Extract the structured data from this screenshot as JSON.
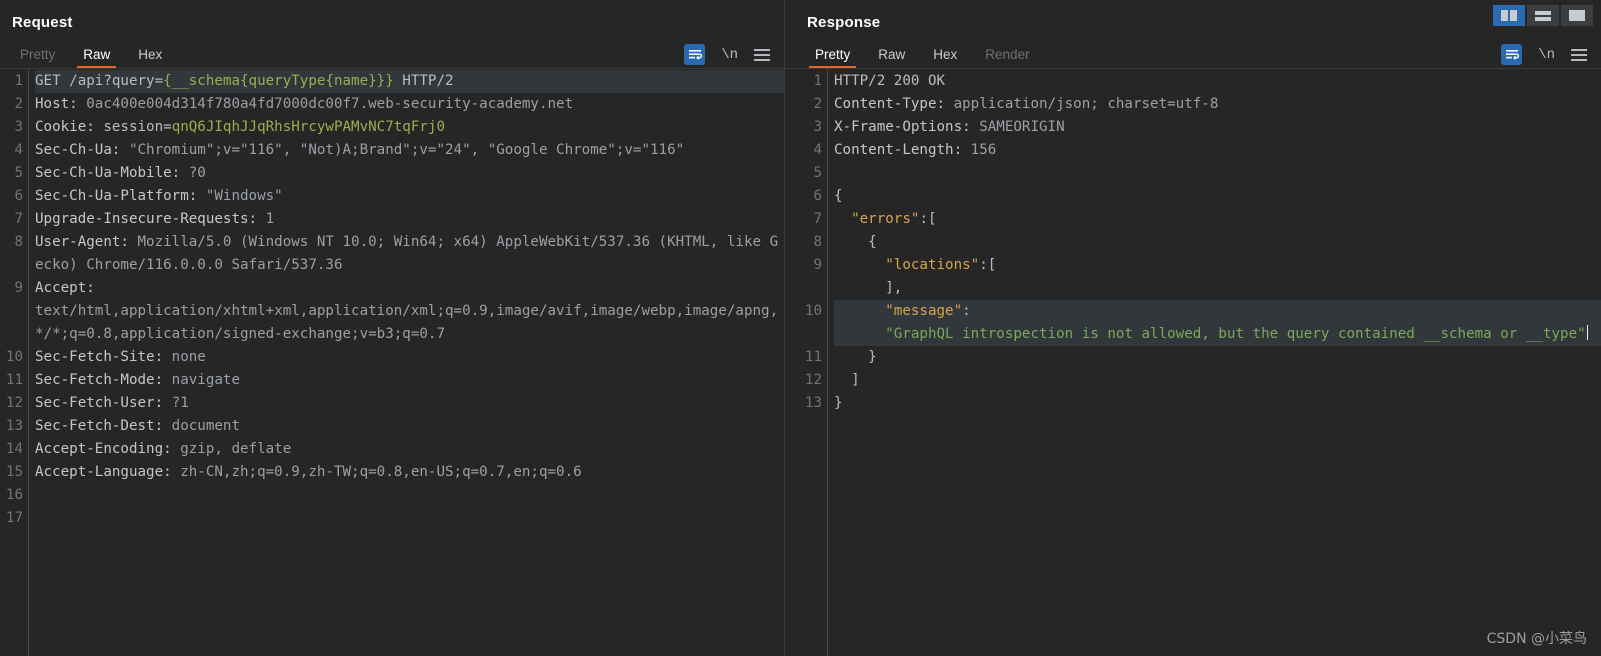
{
  "window": {
    "layout_buttons": [
      {
        "name": "split-vertical",
        "label": "",
        "active": true
      },
      {
        "name": "split-horizontal",
        "label": "",
        "active": false
      },
      {
        "name": "single-pane",
        "label": "",
        "active": false
      }
    ]
  },
  "watermark": "CSDN @小菜鸟",
  "request": {
    "title": "Request",
    "tabs": [
      {
        "label": "Pretty",
        "active": false,
        "enabled": true
      },
      {
        "label": "Raw",
        "active": true,
        "enabled": true
      },
      {
        "label": "Hex",
        "active": false,
        "enabled": true
      }
    ],
    "toolbar": {
      "wrap_icon": "word-wrap-icon",
      "newline_label": "\\n",
      "menu_icon": "hamburger-menu-icon"
    },
    "line_numbers": [
      "1",
      "2",
      "3",
      "4",
      "",
      "5",
      "6",
      "7",
      "8",
      "",
      "9",
      "",
      "",
      "10",
      "11",
      "12",
      "13",
      "14",
      "15",
      "16",
      "17"
    ],
    "lines": [
      {
        "number": "1",
        "highlight": true,
        "segments": [
          {
            "text": "GET /api?query=",
            "color": "default"
          },
          {
            "text": "{__schema{queryType{name}}}",
            "color": "green"
          },
          {
            "text": " HTTP/2",
            "color": "default"
          }
        ]
      },
      {
        "number": "2",
        "highlight": false,
        "segments": [
          {
            "text": "Host: ",
            "color": "hdr"
          },
          {
            "text": "0ac400e004d314f780a4fd7000dc00f7.web-security-academy.net",
            "color": "val"
          }
        ]
      },
      {
        "number": "3",
        "highlight": false,
        "segments": [
          {
            "text": "Cookie: ",
            "color": "hdr"
          },
          {
            "text": "session=",
            "color": "default"
          },
          {
            "text": "qnQ6JIqhJJqRhsHrcywPAMvNC7tqFrj0",
            "color": "green"
          }
        ]
      },
      {
        "number": "4",
        "highlight": false,
        "segments": [
          {
            "text": "Sec-Ch-Ua: ",
            "color": "hdr"
          },
          {
            "text": "\"Chromium\";v=\"116\", \"Not)A;Brand\";v=\"24\", \"Google Chrome\";v=\"116\"",
            "color": "val"
          }
        ]
      },
      {
        "number": "5",
        "highlight": false,
        "segments": [
          {
            "text": "Sec-Ch-Ua-Mobile: ",
            "color": "hdr"
          },
          {
            "text": "?0",
            "color": "val"
          }
        ]
      },
      {
        "number": "6",
        "highlight": false,
        "segments": [
          {
            "text": "Sec-Ch-Ua-Platform: ",
            "color": "hdr"
          },
          {
            "text": "\"Windows\"",
            "color": "val"
          }
        ]
      },
      {
        "number": "7",
        "highlight": false,
        "segments": [
          {
            "text": "Upgrade-Insecure-Requests: ",
            "color": "hdr"
          },
          {
            "text": "1",
            "color": "val"
          }
        ]
      },
      {
        "number": "8",
        "highlight": false,
        "segments": [
          {
            "text": "User-Agent: ",
            "color": "hdr"
          },
          {
            "text": "Mozilla/5.0 (Windows NT 10.0; Win64; x64) AppleWebKit/537.36 (KHTML, like Gecko) Chrome/116.0.0.0 Safari/537.36",
            "color": "val"
          }
        ]
      },
      {
        "number": "9",
        "highlight": false,
        "segments": [
          {
            "text": "Accept: ",
            "color": "hdr"
          },
          {
            "text": "\ntext/html,application/xhtml+xml,application/xml;q=0.9,image/avif,image/webp,image/apng,*/*;q=0.8,application/signed-exchange;v=b3;q=0.7",
            "color": "val"
          }
        ]
      },
      {
        "number": "10",
        "highlight": false,
        "segments": [
          {
            "text": "Sec-Fetch-Site: ",
            "color": "hdr"
          },
          {
            "text": "none",
            "color": "val"
          }
        ]
      },
      {
        "number": "11",
        "highlight": false,
        "segments": [
          {
            "text": "Sec-Fetch-Mode: ",
            "color": "hdr"
          },
          {
            "text": "navigate",
            "color": "val"
          }
        ]
      },
      {
        "number": "12",
        "highlight": false,
        "segments": [
          {
            "text": "Sec-Fetch-User: ",
            "color": "hdr"
          },
          {
            "text": "?1",
            "color": "val"
          }
        ]
      },
      {
        "number": "13",
        "highlight": false,
        "segments": [
          {
            "text": "Sec-Fetch-Dest: ",
            "color": "hdr"
          },
          {
            "text": "document",
            "color": "val"
          }
        ]
      },
      {
        "number": "14",
        "highlight": false,
        "segments": [
          {
            "text": "Accept-Encoding: ",
            "color": "hdr"
          },
          {
            "text": "gzip, deflate",
            "color": "val"
          }
        ]
      },
      {
        "number": "15",
        "highlight": false,
        "segments": [
          {
            "text": "Accept-Language: ",
            "color": "hdr"
          },
          {
            "text": "zh-CN,zh;q=0.9,zh-TW;q=0.8,en-US;q=0.7,en;q=0.6",
            "color": "val"
          }
        ]
      },
      {
        "number": "16",
        "highlight": false,
        "segments": [
          {
            "text": "",
            "color": "default"
          }
        ]
      },
      {
        "number": "17",
        "highlight": false,
        "segments": [
          {
            "text": "",
            "color": "default"
          }
        ]
      }
    ]
  },
  "response": {
    "title": "Response",
    "tabs": [
      {
        "label": "Pretty",
        "active": true,
        "enabled": true
      },
      {
        "label": "Raw",
        "active": false,
        "enabled": true
      },
      {
        "label": "Hex",
        "active": false,
        "enabled": true
      },
      {
        "label": "Render",
        "active": false,
        "enabled": false
      }
    ],
    "toolbar": {
      "wrap_icon": "word-wrap-icon",
      "newline_label": "\\n",
      "menu_icon": "hamburger-menu-icon"
    },
    "lines": [
      {
        "number": "1",
        "highlight": false,
        "segments": [
          {
            "text": "HTTP/2 200 OK",
            "color": "default"
          }
        ]
      },
      {
        "number": "2",
        "highlight": false,
        "segments": [
          {
            "text": "Content-Type: ",
            "color": "hdr"
          },
          {
            "text": "application/json; charset=utf-8",
            "color": "val"
          }
        ]
      },
      {
        "number": "3",
        "highlight": false,
        "segments": [
          {
            "text": "X-Frame-Options: ",
            "color": "hdr"
          },
          {
            "text": "SAMEORIGIN",
            "color": "val"
          }
        ]
      },
      {
        "number": "4",
        "highlight": false,
        "segments": [
          {
            "text": "Content-Length: ",
            "color": "hdr"
          },
          {
            "text": "156",
            "color": "val"
          }
        ]
      },
      {
        "number": "5",
        "highlight": false,
        "segments": [
          {
            "text": "",
            "color": "default"
          }
        ]
      },
      {
        "number": "6",
        "highlight": false,
        "segments": [
          {
            "text": "{",
            "color": "punct"
          }
        ]
      },
      {
        "number": "7",
        "highlight": false,
        "segments": [
          {
            "text": "  ",
            "color": "default"
          },
          {
            "text": "\"errors\"",
            "color": "key"
          },
          {
            "text": ":[",
            "color": "punct"
          }
        ]
      },
      {
        "number": "8",
        "highlight": false,
        "segments": [
          {
            "text": "    {",
            "color": "punct"
          }
        ]
      },
      {
        "number": "9",
        "highlight": false,
        "segments": [
          {
            "text": "      ",
            "color": "default"
          },
          {
            "text": "\"locations\"",
            "color": "key"
          },
          {
            "text": ":[\n      ],",
            "color": "punct"
          }
        ]
      },
      {
        "number": "10",
        "highlight": true,
        "segments": [
          {
            "text": "      ",
            "color": "default"
          },
          {
            "text": "\"message\"",
            "color": "key"
          },
          {
            "text": ":\n      ",
            "color": "punct"
          },
          {
            "text": "\"GraphQL introspection is not allowed, but the query contained __schema or __type\"",
            "color": "str"
          },
          {
            "text": "CARET",
            "color": "caret"
          }
        ]
      },
      {
        "number": "11",
        "highlight": false,
        "segments": [
          {
            "text": "    }",
            "color": "punct"
          }
        ]
      },
      {
        "number": "12",
        "highlight": false,
        "segments": [
          {
            "text": "  ]",
            "color": "punct"
          }
        ]
      },
      {
        "number": "13",
        "highlight": false,
        "segments": [
          {
            "text": "}",
            "color": "punct"
          }
        ]
      }
    ]
  }
}
